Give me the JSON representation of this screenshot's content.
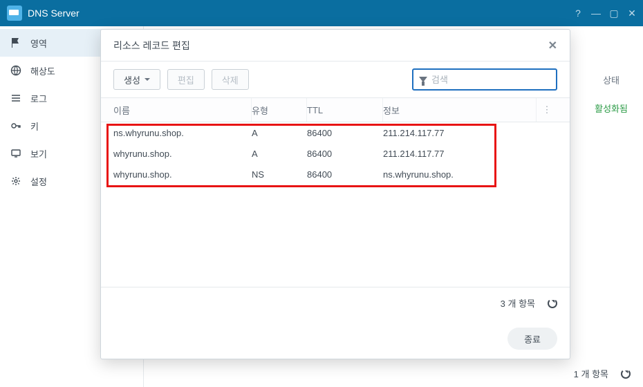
{
  "app": {
    "title": "DNS Server"
  },
  "sidebar": {
    "items": [
      {
        "label": "영역",
        "icon": "flag"
      },
      {
        "label": "해상도",
        "icon": "globe"
      },
      {
        "label": "로그",
        "icon": "list"
      },
      {
        "label": "키",
        "icon": "key"
      },
      {
        "label": "보기",
        "icon": "display"
      },
      {
        "label": "설정",
        "icon": "gear"
      }
    ]
  },
  "status": {
    "header": "상태",
    "value": "활성화됨"
  },
  "bottom": {
    "count_text": "1 개 항목"
  },
  "modal": {
    "title": "리소스 레코드 편집",
    "toolbar": {
      "create": "생성",
      "edit": "편집",
      "delete": "삭제",
      "search_placeholder": "검색"
    },
    "columns": {
      "name": "이름",
      "type": "유형",
      "ttl": "TTL",
      "info": "정보"
    },
    "rows": [
      {
        "name": "ns.whyrunu.shop.",
        "type": "A",
        "ttl": "86400",
        "info": "211.214.117.77"
      },
      {
        "name": "whyrunu.shop.",
        "type": "A",
        "ttl": "86400",
        "info": "211.214.117.77"
      },
      {
        "name": "whyrunu.shop.",
        "type": "NS",
        "ttl": "86400",
        "info": "ns.whyrunu.shop."
      }
    ],
    "footer": {
      "count_text": "3 개 항목"
    },
    "close_btn": "종료"
  }
}
